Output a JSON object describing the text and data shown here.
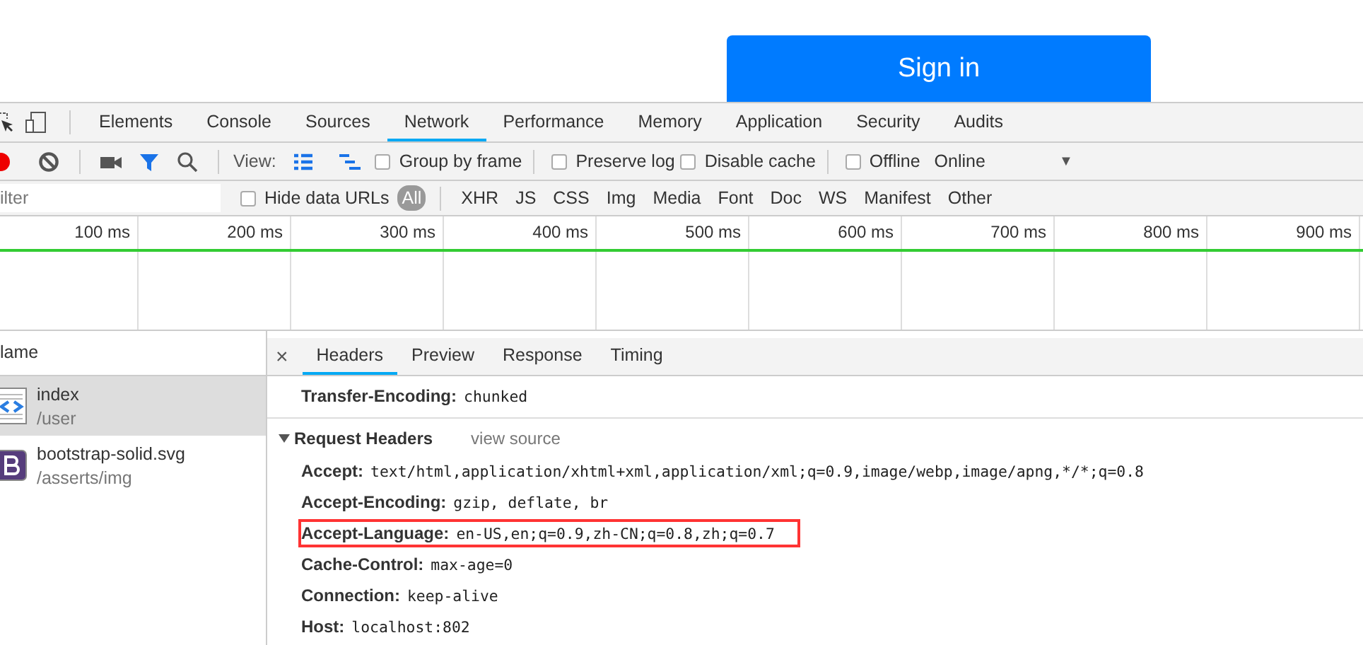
{
  "page": {
    "button": "Sign in"
  },
  "devtools": {
    "tabs": [
      {
        "label": "Elements",
        "selected": false
      },
      {
        "label": "Console",
        "selected": false
      },
      {
        "label": "Sources",
        "selected": false
      },
      {
        "label": "Network",
        "selected": true
      },
      {
        "label": "Performance",
        "selected": false
      },
      {
        "label": "Memory",
        "selected": false
      },
      {
        "label": "Application",
        "selected": false
      },
      {
        "label": "Security",
        "selected": false
      },
      {
        "label": "Audits",
        "selected": false
      }
    ],
    "toolbar": {
      "recording": true,
      "filter_active": true,
      "view_label": "View:",
      "checkboxes": [
        {
          "label": "Group by frame",
          "checked": false
        },
        {
          "label": "Preserve log",
          "checked": false
        },
        {
          "label": "Disable cache",
          "checked": false
        },
        {
          "label": "Offline",
          "checked": false
        }
      ],
      "throttling": "Online",
      "caret": "▼"
    },
    "filter_bar": {
      "placeholder": "ilter",
      "hide_data_urls": {
        "label": "Hide data URLs",
        "checked": false
      },
      "types": [
        {
          "label": "All",
          "selected": true
        },
        {
          "label": "XHR",
          "selected": false
        },
        {
          "label": "JS",
          "selected": false
        },
        {
          "label": "CSS",
          "selected": false
        },
        {
          "label": "Img",
          "selected": false
        },
        {
          "label": "Media",
          "selected": false
        },
        {
          "label": "Font",
          "selected": false
        },
        {
          "label": "Doc",
          "selected": false
        },
        {
          "label": "WS",
          "selected": false
        },
        {
          "label": "Manifest",
          "selected": false
        },
        {
          "label": "Other",
          "selected": false
        }
      ]
    },
    "timeline": {
      "ticks": [
        "100 ms",
        "200 ms",
        "300 ms",
        "400 ms",
        "500 ms",
        "600 ms",
        "700 ms",
        "800 ms",
        "900 ms"
      ]
    },
    "requests": {
      "column": "lame",
      "items": [
        {
          "name": "index",
          "path": "/user",
          "kind": "document",
          "selected": true
        },
        {
          "name": "bootstrap-solid.svg",
          "path": "/asserts/img",
          "kind": "svg",
          "selected": false
        }
      ]
    },
    "detail": {
      "close": "×",
      "tabs": [
        {
          "label": "Headers",
          "selected": true
        },
        {
          "label": "Preview",
          "selected": false
        },
        {
          "label": "Response",
          "selected": false
        },
        {
          "label": "Timing",
          "selected": false
        }
      ],
      "response_tail": [
        {
          "name": "Transfer-Encoding:",
          "value": "chunked"
        }
      ],
      "section": {
        "title": "Request Headers",
        "expanded": true,
        "link": "view source",
        "headers": [
          {
            "name": "Accept:",
            "value": "text/html,application/xhtml+xml,application/xml;q=0.9,image/webp,image/apng,*/*;q=0.8",
            "highlighted": false
          },
          {
            "name": "Accept-Encoding:",
            "value": "gzip, deflate, br",
            "highlighted": false
          },
          {
            "name": "Accept-Language:",
            "value": "en-US,en;q=0.9,zh-CN;q=0.8,zh;q=0.7",
            "highlighted": true
          },
          {
            "name": "Cache-Control:",
            "value": "max-age=0",
            "highlighted": false
          },
          {
            "name": "Connection:",
            "value": "keep-alive",
            "highlighted": false
          },
          {
            "name": "Host:",
            "value": "localhost:802",
            "highlighted": false
          }
        ]
      }
    }
  }
}
